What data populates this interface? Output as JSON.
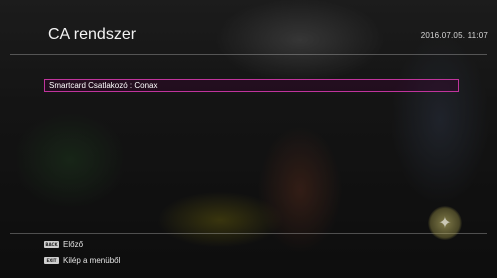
{
  "header": {
    "title": "CA rendszer",
    "datetime": "2016.07.05. 11:07"
  },
  "menu": {
    "items": [
      {
        "label": "Smartcard Csatlakozó : Conax"
      }
    ]
  },
  "footer": {
    "hints": [
      {
        "key": "BACK",
        "label": "Előző"
      },
      {
        "key": "EXIT",
        "label": "Kilép a menüből"
      }
    ]
  },
  "colors": {
    "highlight_border": "#c0349c",
    "text": "#ffffff"
  },
  "icons": {
    "channel_logo": "channel-logo-icon"
  }
}
